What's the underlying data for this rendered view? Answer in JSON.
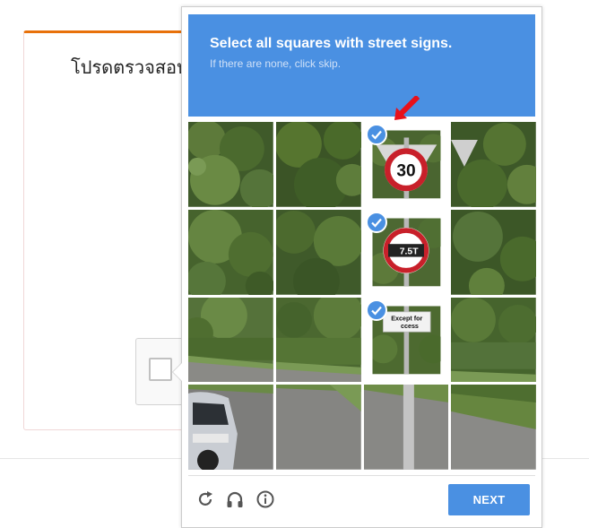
{
  "background": {
    "card_title": "โปรดตรวจสอบ"
  },
  "challenge": {
    "instruction_prefix": "Select all squares with",
    "instruction_target": "street signs.",
    "instruction_sub": "If there are none, click skip.",
    "tiles": [
      {
        "row": 0,
        "col": 0,
        "selected": false
      },
      {
        "row": 0,
        "col": 1,
        "selected": false
      },
      {
        "row": 0,
        "col": 2,
        "selected": true,
        "sign_text": "30"
      },
      {
        "row": 0,
        "col": 3,
        "selected": false
      },
      {
        "row": 1,
        "col": 0,
        "selected": false
      },
      {
        "row": 1,
        "col": 1,
        "selected": false
      },
      {
        "row": 1,
        "col": 2,
        "selected": true,
        "sign_text": "7.5T"
      },
      {
        "row": 1,
        "col": 3,
        "selected": false
      },
      {
        "row": 2,
        "col": 0,
        "selected": false
      },
      {
        "row": 2,
        "col": 1,
        "selected": false
      },
      {
        "row": 2,
        "col": 2,
        "selected": true,
        "sign_text_1": "Except for",
        "sign_text_2": "ccess"
      },
      {
        "row": 2,
        "col": 3,
        "selected": false
      },
      {
        "row": 3,
        "col": 0,
        "selected": false
      },
      {
        "row": 3,
        "col": 1,
        "selected": false
      },
      {
        "row": 3,
        "col": 2,
        "selected": false
      },
      {
        "row": 3,
        "col": 3,
        "selected": false
      }
    ],
    "footer": {
      "icons": [
        "reload-icon",
        "audio-icon",
        "info-icon"
      ],
      "next_label": "NEXT"
    }
  },
  "colors": {
    "accent": "#4a90e2",
    "annotation_arrow": "#e8111a"
  }
}
